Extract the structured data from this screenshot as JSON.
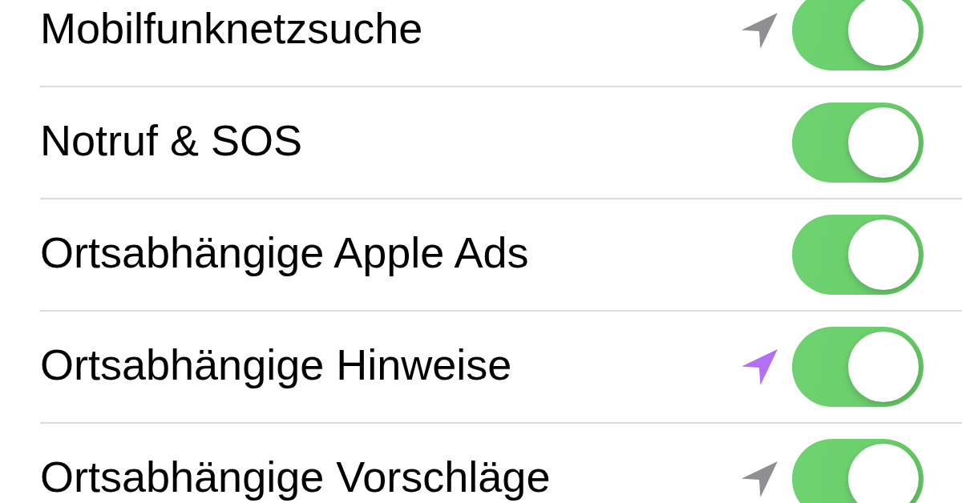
{
  "rows": [
    {
      "label": "Mobilfunknetzsuche",
      "location_arrow": true,
      "color": "#8e8e93",
      "on": true
    },
    {
      "label": "Notruf & SOS",
      "location_arrow": false,
      "on": true
    },
    {
      "label": "Ortsabhängige Apple Ads",
      "location_arrow": false,
      "on": true
    },
    {
      "label": "Ortsabhängige Hinweise",
      "location_arrow": true,
      "color": "#b36ff6",
      "on": true
    },
    {
      "label": "Ortsabhängige Vorschläge",
      "location_arrow": true,
      "color": "#8e8e93",
      "on": true
    }
  ]
}
